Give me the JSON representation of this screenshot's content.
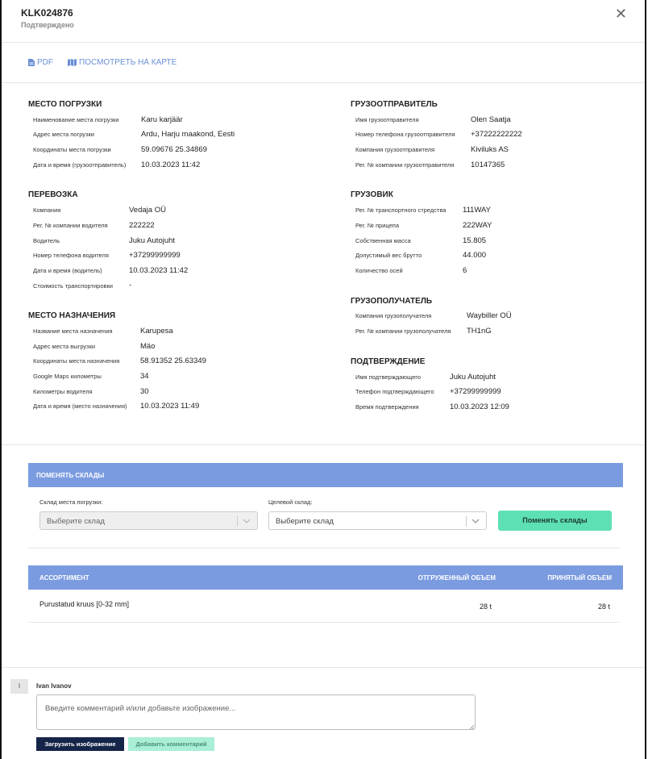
{
  "header": {
    "title": "KLK024876",
    "status": "Подтверждено",
    "close_icon": "close-icon"
  },
  "toolbar": {
    "pdf_label": "PDF",
    "map_label": "ПОСМОТРЕТЬ НА КАРТЕ"
  },
  "loading": {
    "title": "МЕСТО ПОГРУЗКИ",
    "rows": [
      {
        "label": "Наименование места погрузки",
        "value": "Karu karjäär"
      },
      {
        "label": "Адрес места погрузки",
        "value": "Ardu, Harju maakond, Eesti"
      },
      {
        "label": "Координаты места погрузки",
        "value": "59.09676 25.34869"
      },
      {
        "label": "Дата и время (грузоотправитель)",
        "value": "10.03.2023 11:42"
      }
    ]
  },
  "shipper": {
    "title": "ГРУЗООТПРАВИТЕЛЬ",
    "rows": [
      {
        "label": "Имя грузоотправителя",
        "value": "Olen Saatja"
      },
      {
        "label": "Номер телефона грузоотправителя",
        "value": "+37222222222"
      },
      {
        "label": "Компания грузоотправителя",
        "value": "Kiviluks AS"
      },
      {
        "label": "Рег. № компании грузоотправителя",
        "value": "10147365"
      }
    ]
  },
  "transport": {
    "title": "ПЕРЕВОЗКА",
    "rows": [
      {
        "label": "Компания",
        "value": "Vedaja OÜ"
      },
      {
        "label": "Рег. № компании водителя",
        "value": "222222"
      },
      {
        "label": "Водитель",
        "value": "Juku Autojuht"
      },
      {
        "label": "Номер телефона водителя",
        "value": "+37299999999"
      },
      {
        "label": "Дата и время (водитель)",
        "value": "10.03.2023 11:42"
      },
      {
        "label": "Стоимость транспортировки",
        "value": "-"
      }
    ]
  },
  "truck": {
    "title": "ГРУЗОВИК",
    "rows": [
      {
        "label": "Рег. № транспортного стредства",
        "value": "111WAY"
      },
      {
        "label": "Рег. № прицепа",
        "value": "222WAY"
      },
      {
        "label": "Собственная масса",
        "value": "15.805"
      },
      {
        "label": "Допустимый вес брутто",
        "value": "44.000"
      },
      {
        "label": "Количество осей",
        "value": "6"
      }
    ]
  },
  "destination": {
    "title": "МЕСТО НАЗНАЧЕНИЯ",
    "rows": [
      {
        "label": "Название места назначения",
        "value": "Karupesa"
      },
      {
        "label": "Адрес места выгрузки",
        "value": "Mäo"
      },
      {
        "label": "Координаты места назначения",
        "value": "58.91352 25.63349"
      },
      {
        "label": "Google Maps километры",
        "value": "34"
      },
      {
        "label": "Километры водителя",
        "value": "30"
      },
      {
        "label": "Дата и время (место назначения)",
        "value": "10.03.2023 11:49"
      }
    ]
  },
  "consignee": {
    "title": "ГРУЗОПОЛУЧАТЕЛЬ",
    "rows": [
      {
        "label": "Компания грузополучателя",
        "value": "Waybiller OÜ"
      },
      {
        "label": "Рег. № компании грузополучателя",
        "value": "TH1nG"
      }
    ]
  },
  "confirmation": {
    "title": "ПОДТВЕРЖДЕНИЕ",
    "rows": [
      {
        "label": "Имя подтверждающего",
        "value": "Juku Autojuht"
      },
      {
        "label": "Телефон подтверждающего",
        "value": "+37299999999"
      },
      {
        "label": "Время подтверждения",
        "value": "10.03.2023 12:09"
      }
    ]
  },
  "warehouses": {
    "title": "ПОМЕНЯТЬ СКЛАДЫ",
    "source_label": "Склад места погрузки:",
    "source_placeholder": "Выберите склад",
    "target_label": "Целевой склад:",
    "target_placeholder": "Выберите склад",
    "button": "Поменять склады"
  },
  "assortment": {
    "headers": {
      "name": "АССОРТИМЕНТ",
      "shipped": "ОТГРУЖЕННЫЙ ОБЪЕМ",
      "received": "ПРИНЯТЫЙ ОБЪЕМ"
    },
    "rows": [
      {
        "name": "Purustatud kruus [0-32 mm]",
        "shipped": "28 t",
        "received": "28 t"
      }
    ]
  },
  "comments": {
    "avatar_initial": "I",
    "user": "Ivan Ivanov",
    "placeholder": "Введите комментарий и/или добавьте изображение...",
    "upload_button": "Загрузить изображение",
    "add_button": "Добавить комментарий"
  },
  "colors": {
    "accent_blue": "#7b9be0",
    "link_blue": "#6b8fd6",
    "green": "#5ee0b5",
    "dark_navy": "#15254a"
  }
}
